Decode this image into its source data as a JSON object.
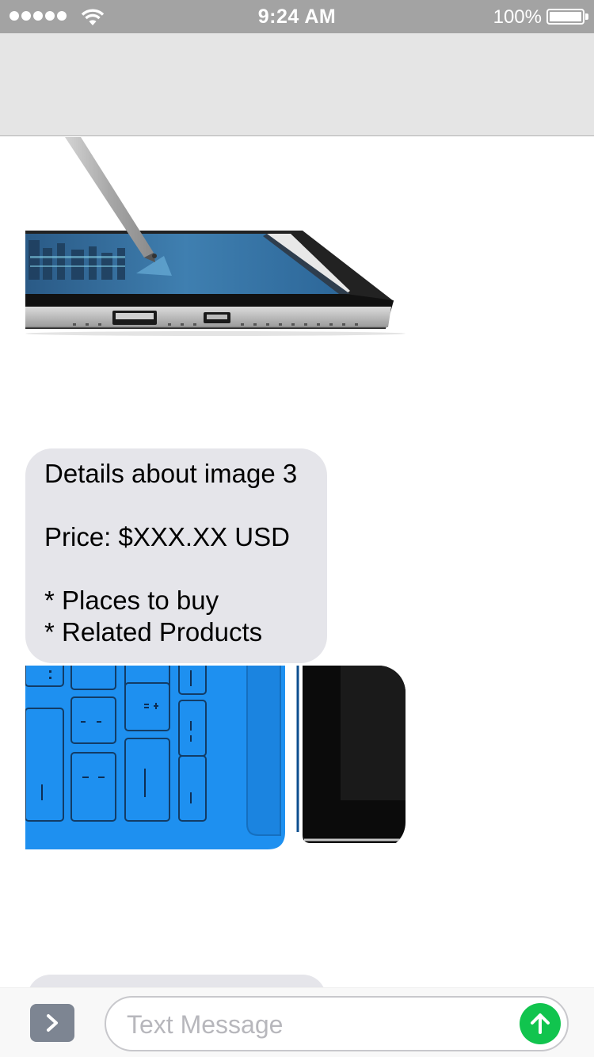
{
  "status_bar": {
    "time": "9:24 AM",
    "battery_percent": "100%",
    "signal_bars": 5,
    "icons": [
      "signal-icon",
      "wifi-icon",
      "battery-icon"
    ]
  },
  "thread": {
    "image_1": {
      "subject": "tablet-with-stylus-image"
    },
    "message": {
      "line1": "Details about image 3",
      "line2": "Price: $XXX.XX USD",
      "line3": "* Places to buy",
      "line4": "* Related Products"
    },
    "image_2": {
      "subject": "blue-keyboard-cover-image"
    }
  },
  "compose": {
    "placeholder": "Text Message",
    "expand_icon": "chevron-right-icon",
    "send_icon": "arrow-up-icon"
  },
  "colors": {
    "status_bar": "#a3a3a3",
    "nav_bar": "#e5e5e5",
    "bubble": "#e5e5ea",
    "send": "#11c44e",
    "keyboard_blue": "#1e90f0"
  }
}
